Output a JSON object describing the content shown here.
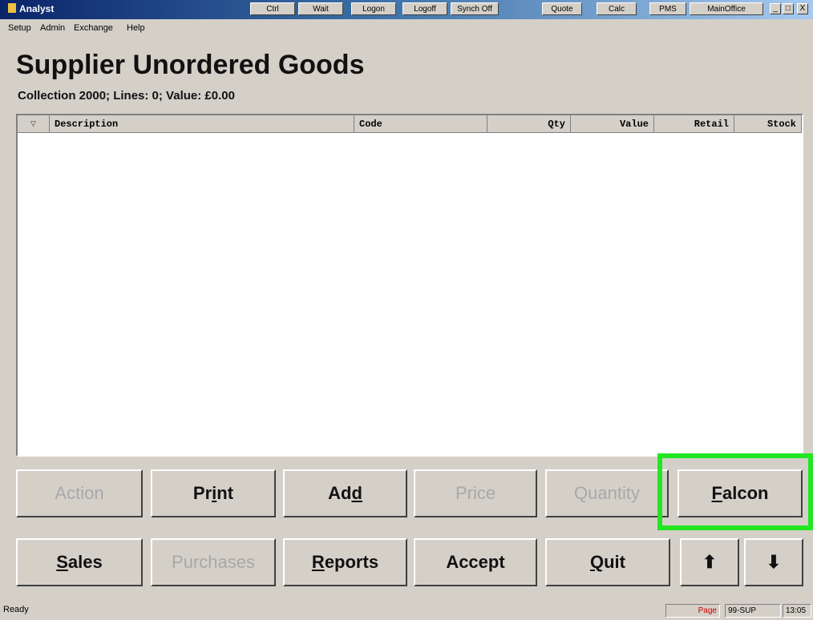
{
  "window": {
    "title": "Analyst"
  },
  "toolbar": {
    "buttons": [
      "Ctrl",
      "Wait",
      "Logon",
      "Logoff",
      "Synch Off",
      "Quote",
      "Calc",
      "PMS",
      "MainOffice"
    ]
  },
  "window_controls": {
    "minimize": "_",
    "maximize": "□",
    "close": "X"
  },
  "menu": [
    "Setup",
    "Admin",
    "Exchange",
    "Help"
  ],
  "page": {
    "title": "Supplier Unordered Goods",
    "subtitle": "Collection 2000; Lines: 0;  Value: £0.00"
  },
  "table": {
    "sort_icon": "▽",
    "columns": [
      "Description",
      "Code",
      "Qty",
      "Value",
      "Retail",
      "Stock"
    ],
    "rows": []
  },
  "buttons_row1": [
    {
      "label": "Action",
      "enabled": false
    },
    {
      "label": "Print",
      "enabled": true
    },
    {
      "label": "Add",
      "enabled": true
    },
    {
      "label": "Price",
      "enabled": false
    },
    {
      "label": "Quantity",
      "enabled": false
    },
    {
      "label": "Falcon",
      "enabled": true
    }
  ],
  "buttons_row2": [
    {
      "label": "Sales",
      "enabled": true
    },
    {
      "label": "Purchases",
      "enabled": false
    },
    {
      "label": "Reports",
      "enabled": true
    },
    {
      "label": "Accept",
      "enabled": true
    },
    {
      "label": "Quit",
      "enabled": true
    }
  ],
  "arrows": {
    "up": "⬆",
    "down": "⬇"
  },
  "highlight_color": "#22e622",
  "status": {
    "text": "Ready",
    "page": "Page",
    "code": "99-SUP",
    "time": "13:05"
  }
}
